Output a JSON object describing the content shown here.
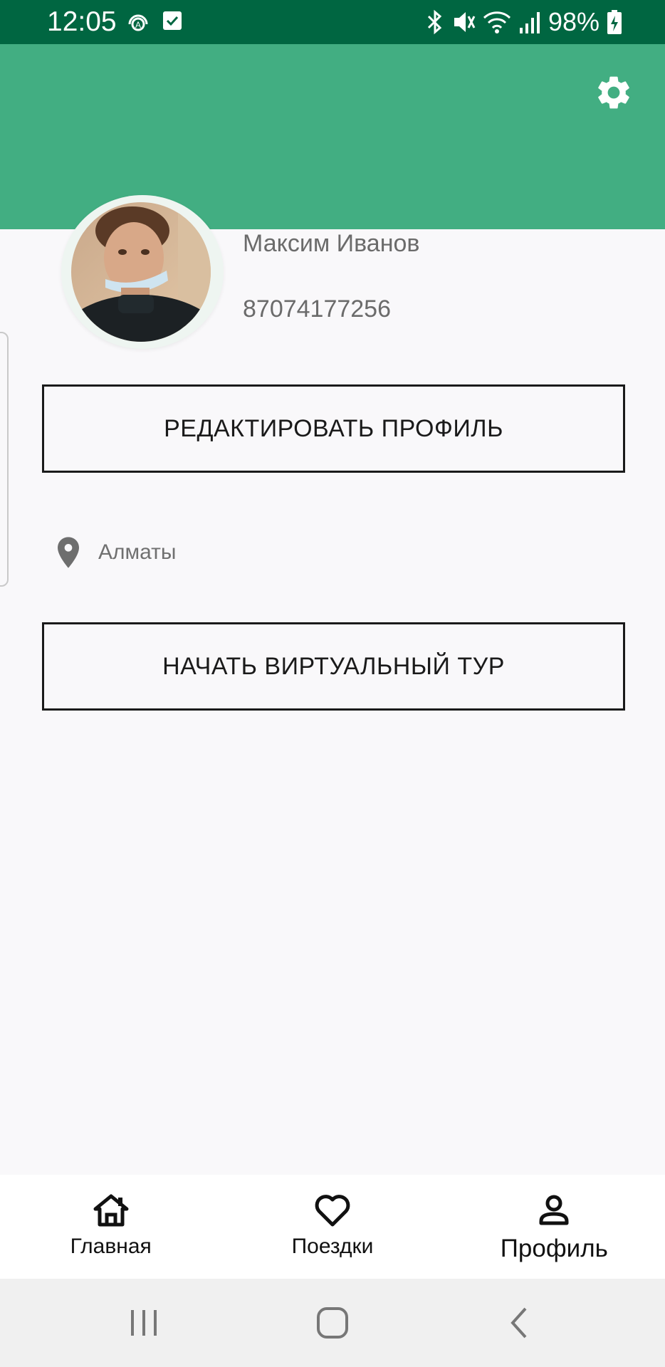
{
  "status_bar": {
    "time": "12:05",
    "battery": "98%"
  },
  "profile": {
    "name": "Максим Иванов",
    "phone": "87074177256",
    "location": "Алматы"
  },
  "actions": {
    "edit_profile": "РЕДАКТИРОВАТЬ ПРОФИЛЬ",
    "start_tour": "НАЧАТЬ ВИРТУАЛЬНЫЙ ТУР"
  },
  "bottom_nav": {
    "items": [
      {
        "label": "Главная",
        "icon": "home-icon"
      },
      {
        "label": "Поездки",
        "icon": "heart-icon"
      },
      {
        "label": "Профиль",
        "icon": "person-icon",
        "active": true
      }
    ]
  },
  "colors": {
    "status_bar": "#006641",
    "header": "#42ae82",
    "background": "#f9f8fa"
  }
}
